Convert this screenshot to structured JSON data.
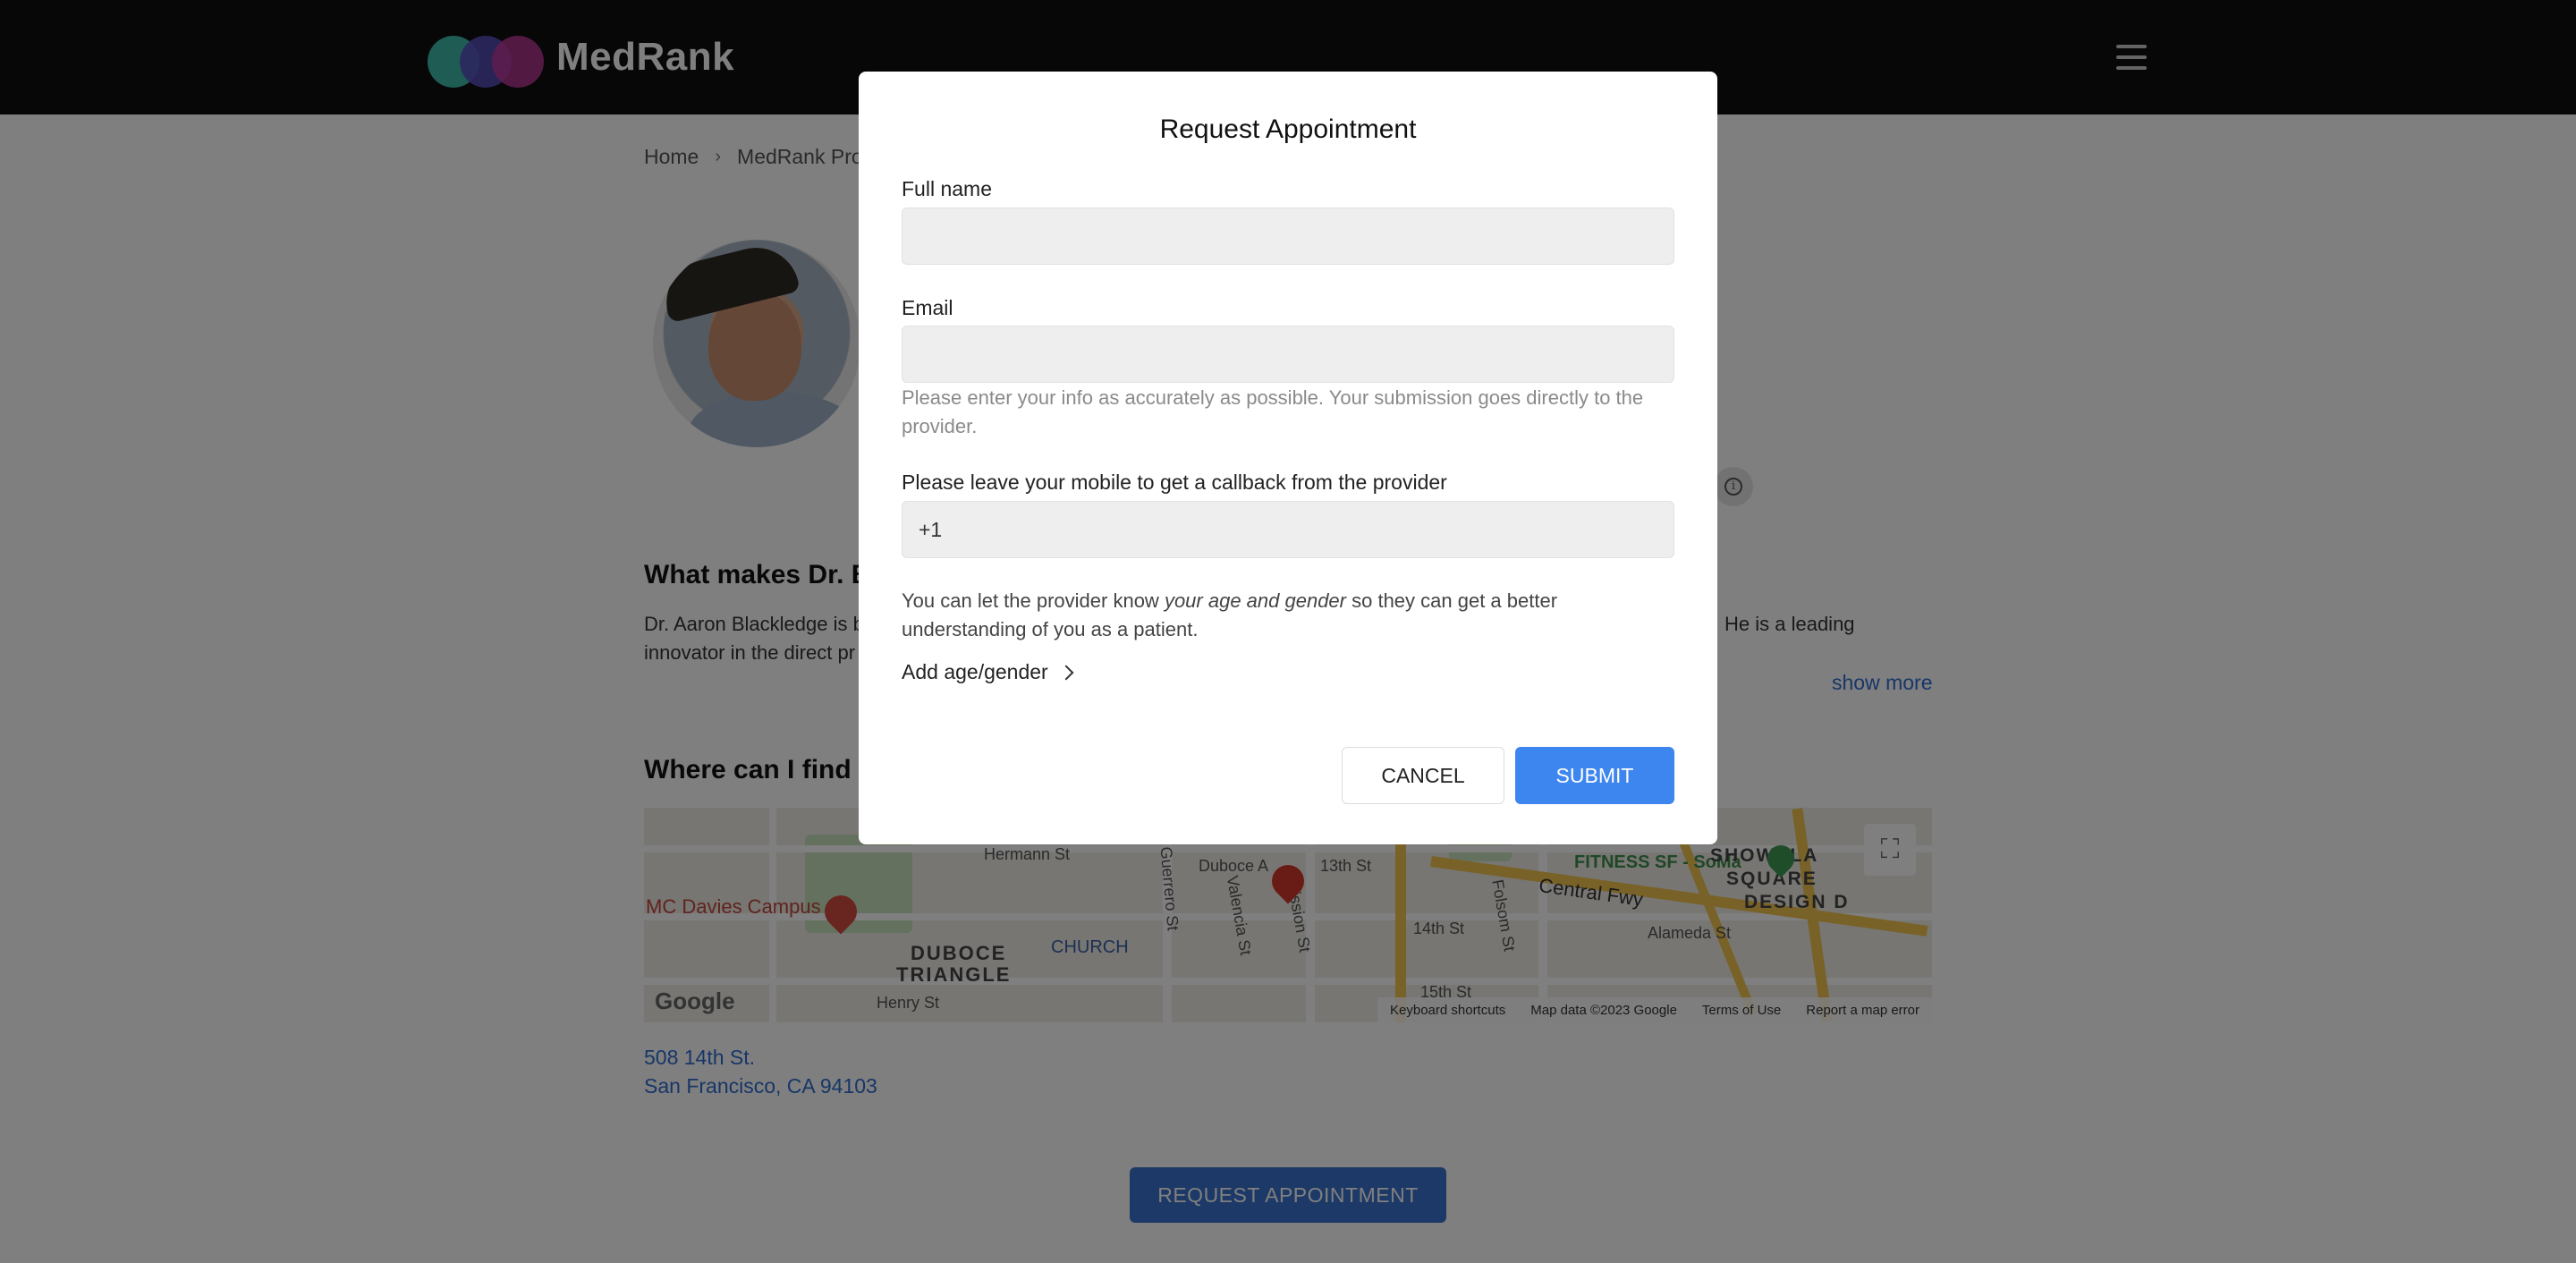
{
  "brand": {
    "name": "MedRank"
  },
  "breadcrumb": {
    "items": [
      "Home",
      "MedRank Prov"
    ]
  },
  "page": {
    "section_what_heading": "What makes Dr. Bl",
    "section_what_text": "Dr. Aaron Blackledge is b",
    "section_what_text_line2": "innovator in the direct pr",
    "section_what_text_right": "He is a leading",
    "show_more": "show more",
    "section_where_heading": "Where can I find D",
    "address_line1": "508 14th St.",
    "address_line2": "San Francisco, CA 94103",
    "request_button": "REQUEST APPOINTMENT"
  },
  "map": {
    "labels": {
      "hospital": "MC Davies Campus",
      "duboce": "DUBOCE",
      "triangle": "TRIANGLE",
      "church": "CHURCH",
      "fitness": "FITNESS SF - SoMa",
      "central_fwy": "Central Fwy",
      "hermann": "Hermann St",
      "duboce_av": "Duboce A",
      "st13": "13th St",
      "st14": "14th St",
      "st15": "15th St",
      "valencia": "Valencia St",
      "mission": "Mission St",
      "guerrero": "Guerrero St",
      "folsom": "Folsom St",
      "alameda": "Alameda St",
      "henry": "Henry St",
      "showplace": "SHOWPLA",
      "square": "SQUARE",
      "design": "DESIGN D"
    },
    "google_logo": "Google",
    "footer": {
      "shortcuts": "Keyboard shortcuts",
      "data": "Map data ©2023 Google",
      "terms": "Terms of Use",
      "report": "Report a map error"
    }
  },
  "modal": {
    "title": "Request Appointment",
    "full_name_label": "Full name",
    "full_name_value": "",
    "email_label": "Email",
    "email_value": "",
    "email_help": "Please enter your info as accurately as possible. Your submission goes directly to the provider.",
    "mobile_label": "Please leave your mobile to get a callback from the provider",
    "mobile_value": "+1",
    "note_prefix": "You can let the provider know ",
    "note_emphasis": "your age and gender",
    "note_suffix": " so they can get a better understanding of you as a patient.",
    "add_age_gender": "Add age/gender",
    "cancel": "CANCEL",
    "submit": "SUBMIT"
  },
  "colors": {
    "accent": "#3d85ef",
    "link": "#2f6dd0",
    "topbar": "#0f0f10"
  }
}
